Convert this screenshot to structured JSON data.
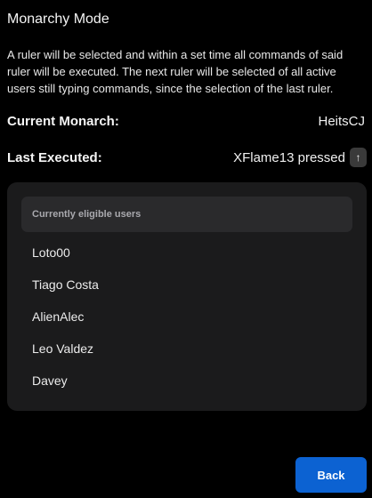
{
  "title": "Monarchy Mode",
  "description": "A ruler will be selected and within a set time all commands of said ruler will be executed. The next ruler will be selected of all active users still typing commands, since the selection of the last ruler.",
  "current_monarch": {
    "label": "Current Monarch:",
    "value": "HeitsCJ"
  },
  "last_executed": {
    "label": "Last Executed:",
    "value": "XFlame13 pressed",
    "key_icon": "arrow-up-icon",
    "key_glyph": "↑"
  },
  "eligible_users": {
    "header": "Currently eligible users",
    "users": [
      "Loto00",
      "Tiago Costa",
      "AlienAlec",
      "Leo Valdez",
      "Davey"
    ]
  },
  "back_button": {
    "label": "Back"
  },
  "colors": {
    "background": "#000000",
    "panel": "#1b1b1c",
    "panel_header": "#2a2a2c",
    "accent": "#0c62d2"
  }
}
